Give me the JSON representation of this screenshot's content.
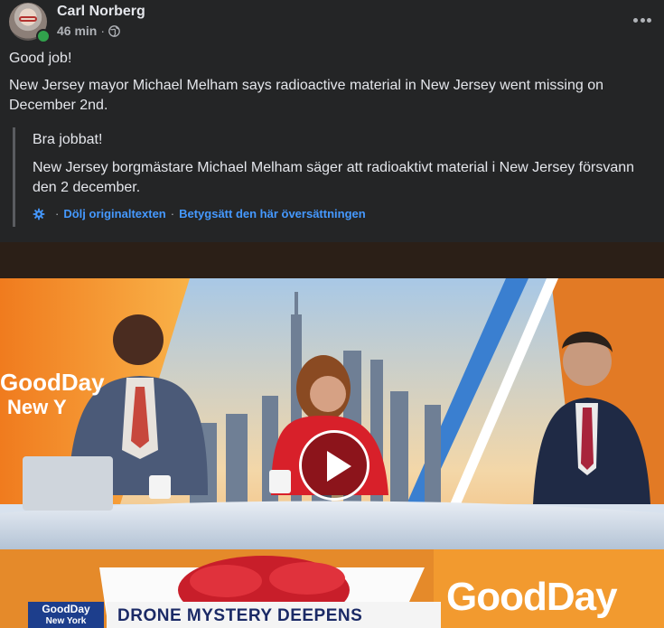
{
  "post": {
    "author": "Carl Norberg",
    "time": "46 min",
    "separator": "·",
    "privacy_icon": "globe-icon",
    "more_icon": "more-options-icon",
    "text_line1": "Good job!",
    "text_line2": "New Jersey mayor Michael Melham says radioactive material in New Jersey went missing on December 2nd.",
    "translation": {
      "line1": "Bra jobbat!",
      "line2": "New Jersey borgmästare Michael Melham säger att radioaktivt material i New Jersey försvann den 2 december.",
      "hide_original": "Dölj originaltexten",
      "rate_translation": "Betygsätt den här översättningen",
      "separator": "·"
    }
  },
  "media": {
    "type": "video",
    "play_icon": "play-icon",
    "wall_text_left_1": "GoodDay",
    "wall_text_left_2": "New Y",
    "wall_text_right": "GoodDay",
    "lower_third_brand_1": "GoodDay",
    "lower_third_brand_2": "New York",
    "headline": "DRONE MYSTERY DEEPENS"
  },
  "colors": {
    "background": "#242526",
    "text": "#e4e6eb",
    "secondary": "#b0b3b8",
    "link": "#4599ff",
    "online": "#31a24c"
  }
}
